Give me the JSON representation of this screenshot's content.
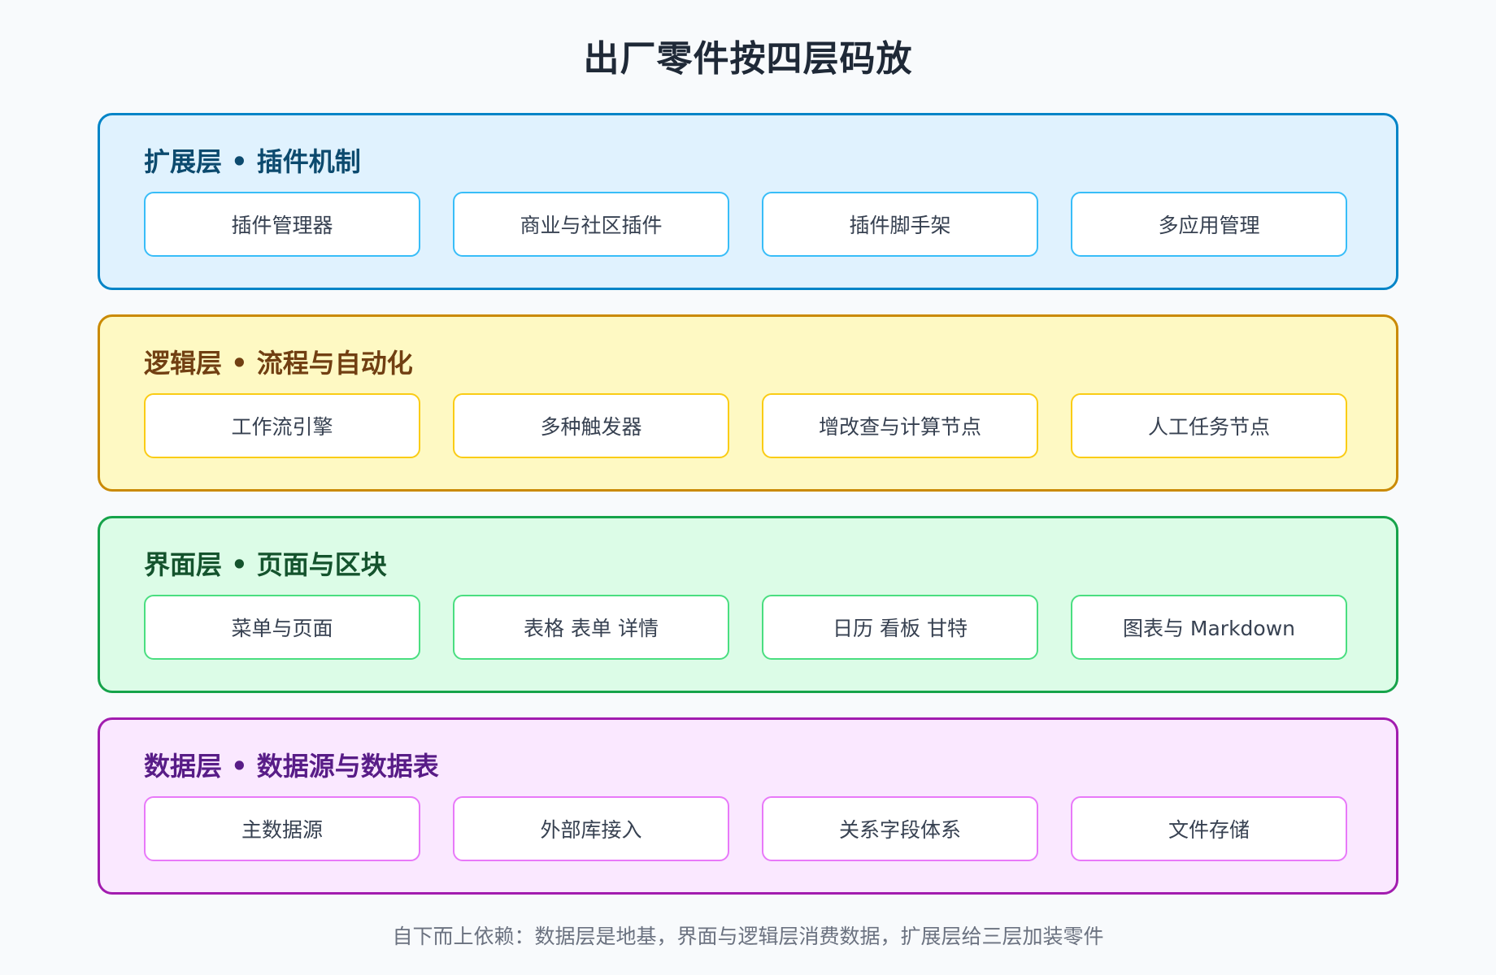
{
  "title": "出厂零件按四层码放",
  "layers": [
    {
      "title": "扩展层 • 插件机制",
      "accent": "#0284c7",
      "background": "#e0f2fe",
      "cards": [
        "插件管理器",
        "商业与社区插件",
        "插件脚手架",
        "多应用管理"
      ]
    },
    {
      "title": "逻辑层 • 流程与自动化",
      "accent": "#ca8a04",
      "background": "#fef9c3",
      "cards": [
        "工作流引擎",
        "多种触发器",
        "增改查与计算节点",
        "人工任务节点"
      ]
    },
    {
      "title": "界面层 • 页面与区块",
      "accent": "#16a34a",
      "background": "#dcfce7",
      "cards": [
        "菜单与页面",
        "表格 表单 详情",
        "日历 看板 甘特",
        "图表与 Markdown"
      ]
    },
    {
      "title": "数据层 • 数据源与数据表",
      "accent": "#a21caf",
      "background": "#fae8ff",
      "cards": [
        "主数据源",
        "外部库接入",
        "关系字段体系",
        "文件存储"
      ]
    }
  ],
  "footnote": "自下而上依赖：数据层是地基，界面与逻辑层消费数据，扩展层给三层加装零件"
}
